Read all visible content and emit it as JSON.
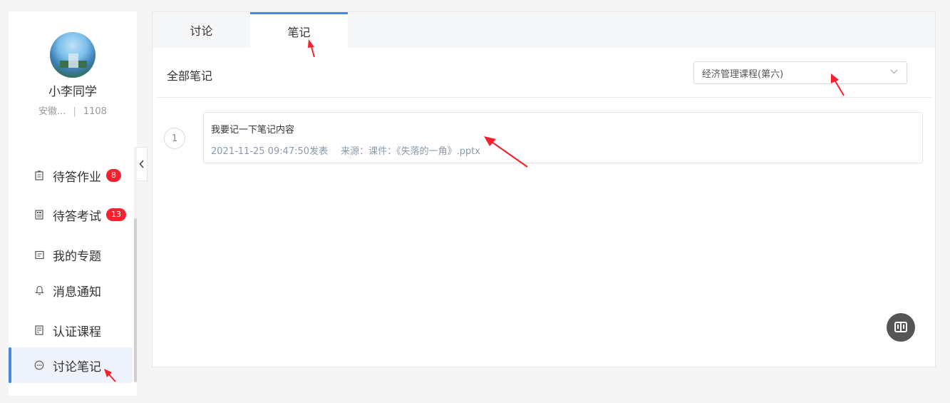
{
  "user": {
    "name": "小李同学",
    "school": "安徽...",
    "id": "1108"
  },
  "sidebar": {
    "items": [
      {
        "label": "待答作业",
        "icon": "clipboard-icon",
        "badge": "8"
      },
      {
        "label": "待答考试",
        "icon": "exam-sheet-icon",
        "badge": "13"
      },
      {
        "label": "我的专题",
        "icon": "topic-icon",
        "badge": ""
      },
      {
        "label": "消息通知",
        "icon": "bell-icon",
        "badge": ""
      },
      {
        "label": "认证课程",
        "icon": "certificate-icon",
        "badge": ""
      },
      {
        "label": "讨论笔记",
        "icon": "chat-bubble-icon",
        "badge": ""
      }
    ],
    "active_index": 5
  },
  "tabs": [
    {
      "label": "讨论"
    },
    {
      "label": "笔记"
    }
  ],
  "active_tab": 1,
  "notes": {
    "section_title": "全部笔记",
    "course_select": {
      "value": "经济管理课程(第六)"
    },
    "items": [
      {
        "index": "1",
        "content": "我要记一下笔记内容",
        "published": "2021-11-25 09:47:50发表",
        "source": "来源：课件：《失落的一角》.pptx"
      }
    ]
  },
  "colors": {
    "accent": "#4a86e8",
    "badge": "#f5222d",
    "annotation_arrow": "#f5222d"
  },
  "float_button": {
    "icon": "book-icon"
  }
}
